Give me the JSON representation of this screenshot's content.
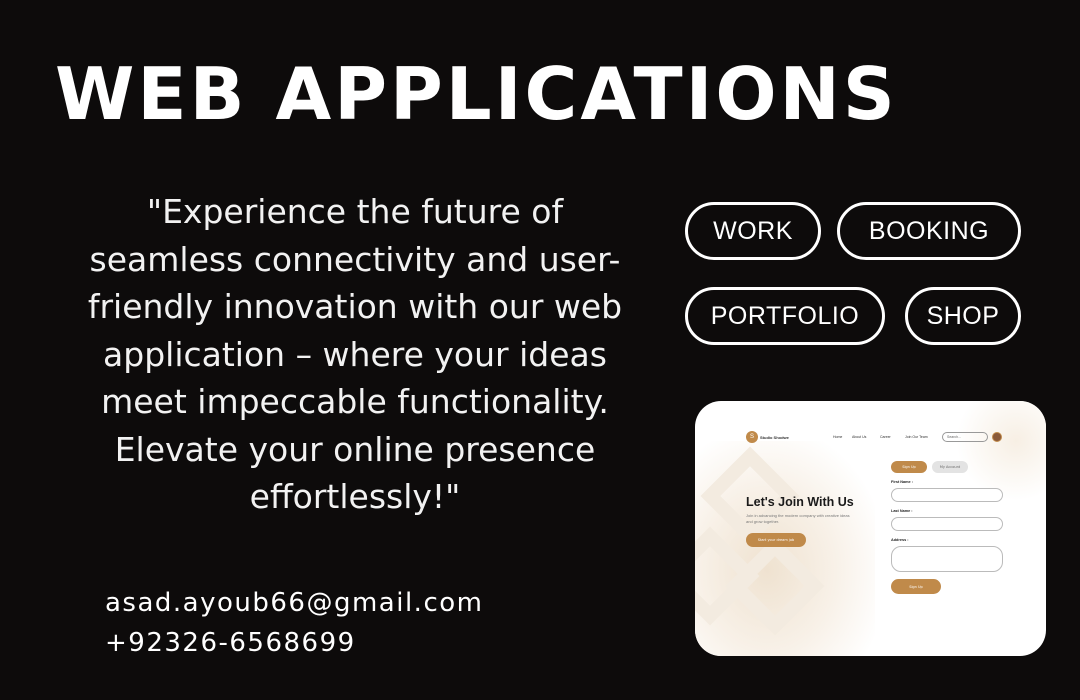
{
  "title": "WEB APPLICATIONS",
  "quote": "\"Experience the future of seamless connectivity and user-friendly innovation with our web application – where your ideas meet impeccable functionality. Elevate your online presence effortlessly!\"",
  "contact": {
    "email": "asad.ayoub66@gmail.com",
    "phone": "+92326-6568699"
  },
  "tags": [
    "WORK",
    "BOOKING",
    "PORTFOLIO",
    "SHOP"
  ],
  "mockup": {
    "logo_glyph": "S",
    "brand": "Studio Shodwe",
    "nav": [
      "Home",
      "About Us",
      "Career",
      "Join Our Team"
    ],
    "search_placeholder": "Search...",
    "hero_title": "Let's Join With Us",
    "hero_subtitle": "Join in advancing the modern company with creative ideas and grow together.",
    "cta": "Start your dream job",
    "tabs": [
      "Sign Up",
      "My Account"
    ],
    "fields": [
      "First Name :",
      "Last Name :",
      "Address :"
    ],
    "submit": "Sign Up",
    "accent_color": "#c08a4a"
  }
}
